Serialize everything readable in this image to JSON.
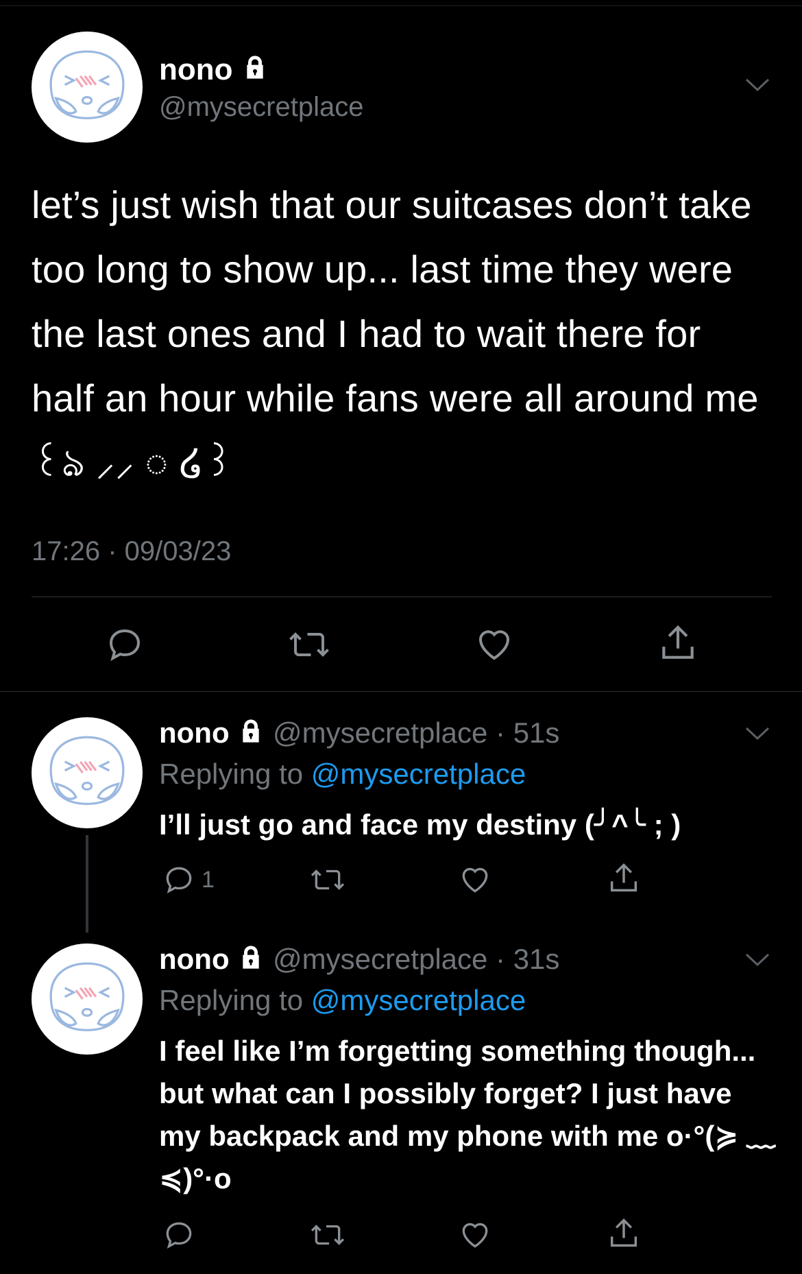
{
  "main_tweet": {
    "name": "nono",
    "handle": "@mysecretplace",
    "text": "let’s just wish that our suitcases don’t take too long to show up... last time they were the last ones and I had to wait there for half an hour while fans were all around me ꒰ঌ ⸝⸝ ◌ ໒꒱",
    "timestamp": "17:26 · 09/03/23"
  },
  "replies": [
    {
      "name": "nono",
      "handle": "@mysecretplace",
      "time": "51s",
      "replying_label": "Replying to",
      "replying_handle": "@mysecretplace",
      "text": "I’ll just go and face my destiny (╯^╰ ; )",
      "reply_count": "1"
    },
    {
      "name": "nono",
      "handle": "@mysecretplace",
      "time": "31s",
      "replying_label": "Replying to",
      "replying_handle": "@mysecretplace",
      "text": "I feel like I’m forgetting something though... but what can I possibly forget? I just have my backpack and my phone with me o·°(≽ ﹏ ≼)°·o",
      "reply_count": ""
    }
  ],
  "icons": {
    "lock": "lock-icon",
    "chevron": "chevron-down-icon",
    "reply": "reply-icon",
    "retweet": "retweet-icon",
    "like": "heart-icon",
    "share": "share-icon"
  },
  "colors": {
    "background": "#000000",
    "text": "#ffffff",
    "secondary": "#71767b",
    "accent": "#1d9bf0"
  }
}
